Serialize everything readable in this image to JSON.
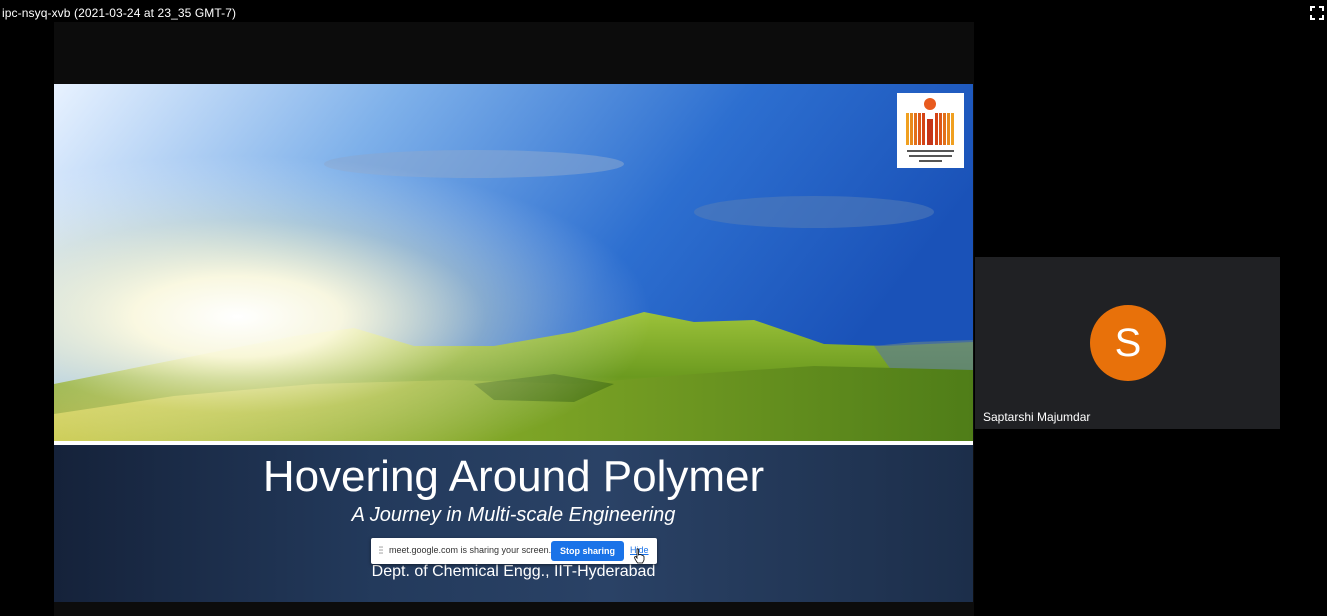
{
  "meeting": {
    "title": "ipc-nsyq-xvb (2021-03-24 at 23_35 GMT-7)"
  },
  "slide": {
    "title": "Hovering Around Polymer",
    "subtitle": "A Journey in Multi-scale Engineering",
    "department": "Dept. of Chemical Engg., IIT-Hyderabad"
  },
  "share_bar": {
    "message": "meet.google.com is sharing your screen.",
    "stop_label": "Stop sharing",
    "hide_label": "Hide"
  },
  "participant": {
    "initial": "S",
    "name": "Saptarshi Majumdar",
    "avatar_color": "#e8710a"
  },
  "icons": {
    "fullscreen": "fullscreen-icon",
    "grip": "drag-handle-icon",
    "cursor": "hand-cursor-icon"
  },
  "colors": {
    "accent": "#1a73e8",
    "tile_bg": "#202124"
  }
}
